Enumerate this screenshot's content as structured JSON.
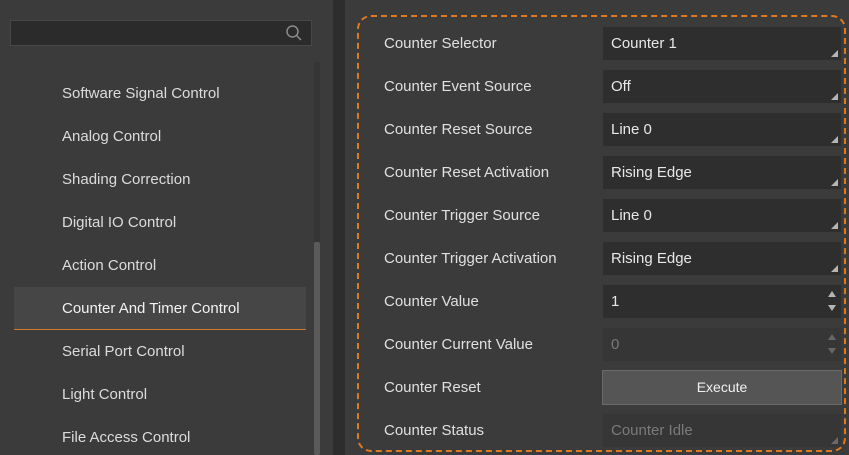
{
  "search": {
    "placeholder": ""
  },
  "sidebar": {
    "items": [
      {
        "label": "Software Signal Control"
      },
      {
        "label": "Analog Control"
      },
      {
        "label": "Shading Correction"
      },
      {
        "label": "Digital IO Control"
      },
      {
        "label": "Action Control"
      },
      {
        "label": "Counter And Timer Control",
        "active": true
      },
      {
        "label": "Serial Port Control"
      },
      {
        "label": "Light Control"
      },
      {
        "label": "File Access Control"
      }
    ]
  },
  "properties": [
    {
      "label": "Counter Selector",
      "value": "Counter 1",
      "kind": "dropdown"
    },
    {
      "label": "Counter Event Source",
      "value": "Off",
      "kind": "dropdown"
    },
    {
      "label": "Counter Reset Source",
      "value": "Line 0",
      "kind": "dropdown"
    },
    {
      "label": "Counter Reset Activation",
      "value": "Rising Edge",
      "kind": "dropdown"
    },
    {
      "label": "Counter Trigger Source",
      "value": "Line 0",
      "kind": "dropdown"
    },
    {
      "label": "Counter Trigger Activation",
      "value": "Rising Edge",
      "kind": "dropdown"
    },
    {
      "label": "Counter Value",
      "value": "1",
      "kind": "spinbox"
    },
    {
      "label": "Counter Current Value",
      "value": "0",
      "kind": "spinbox-disabled"
    },
    {
      "label": "Counter Reset",
      "value": "Execute",
      "kind": "button"
    },
    {
      "label": "Counter Status",
      "value": "Counter Idle",
      "kind": "dropdown-disabled"
    }
  ],
  "colors": {
    "highlight_dash": "#e07a1f",
    "active_underline": "#d07a2a"
  }
}
